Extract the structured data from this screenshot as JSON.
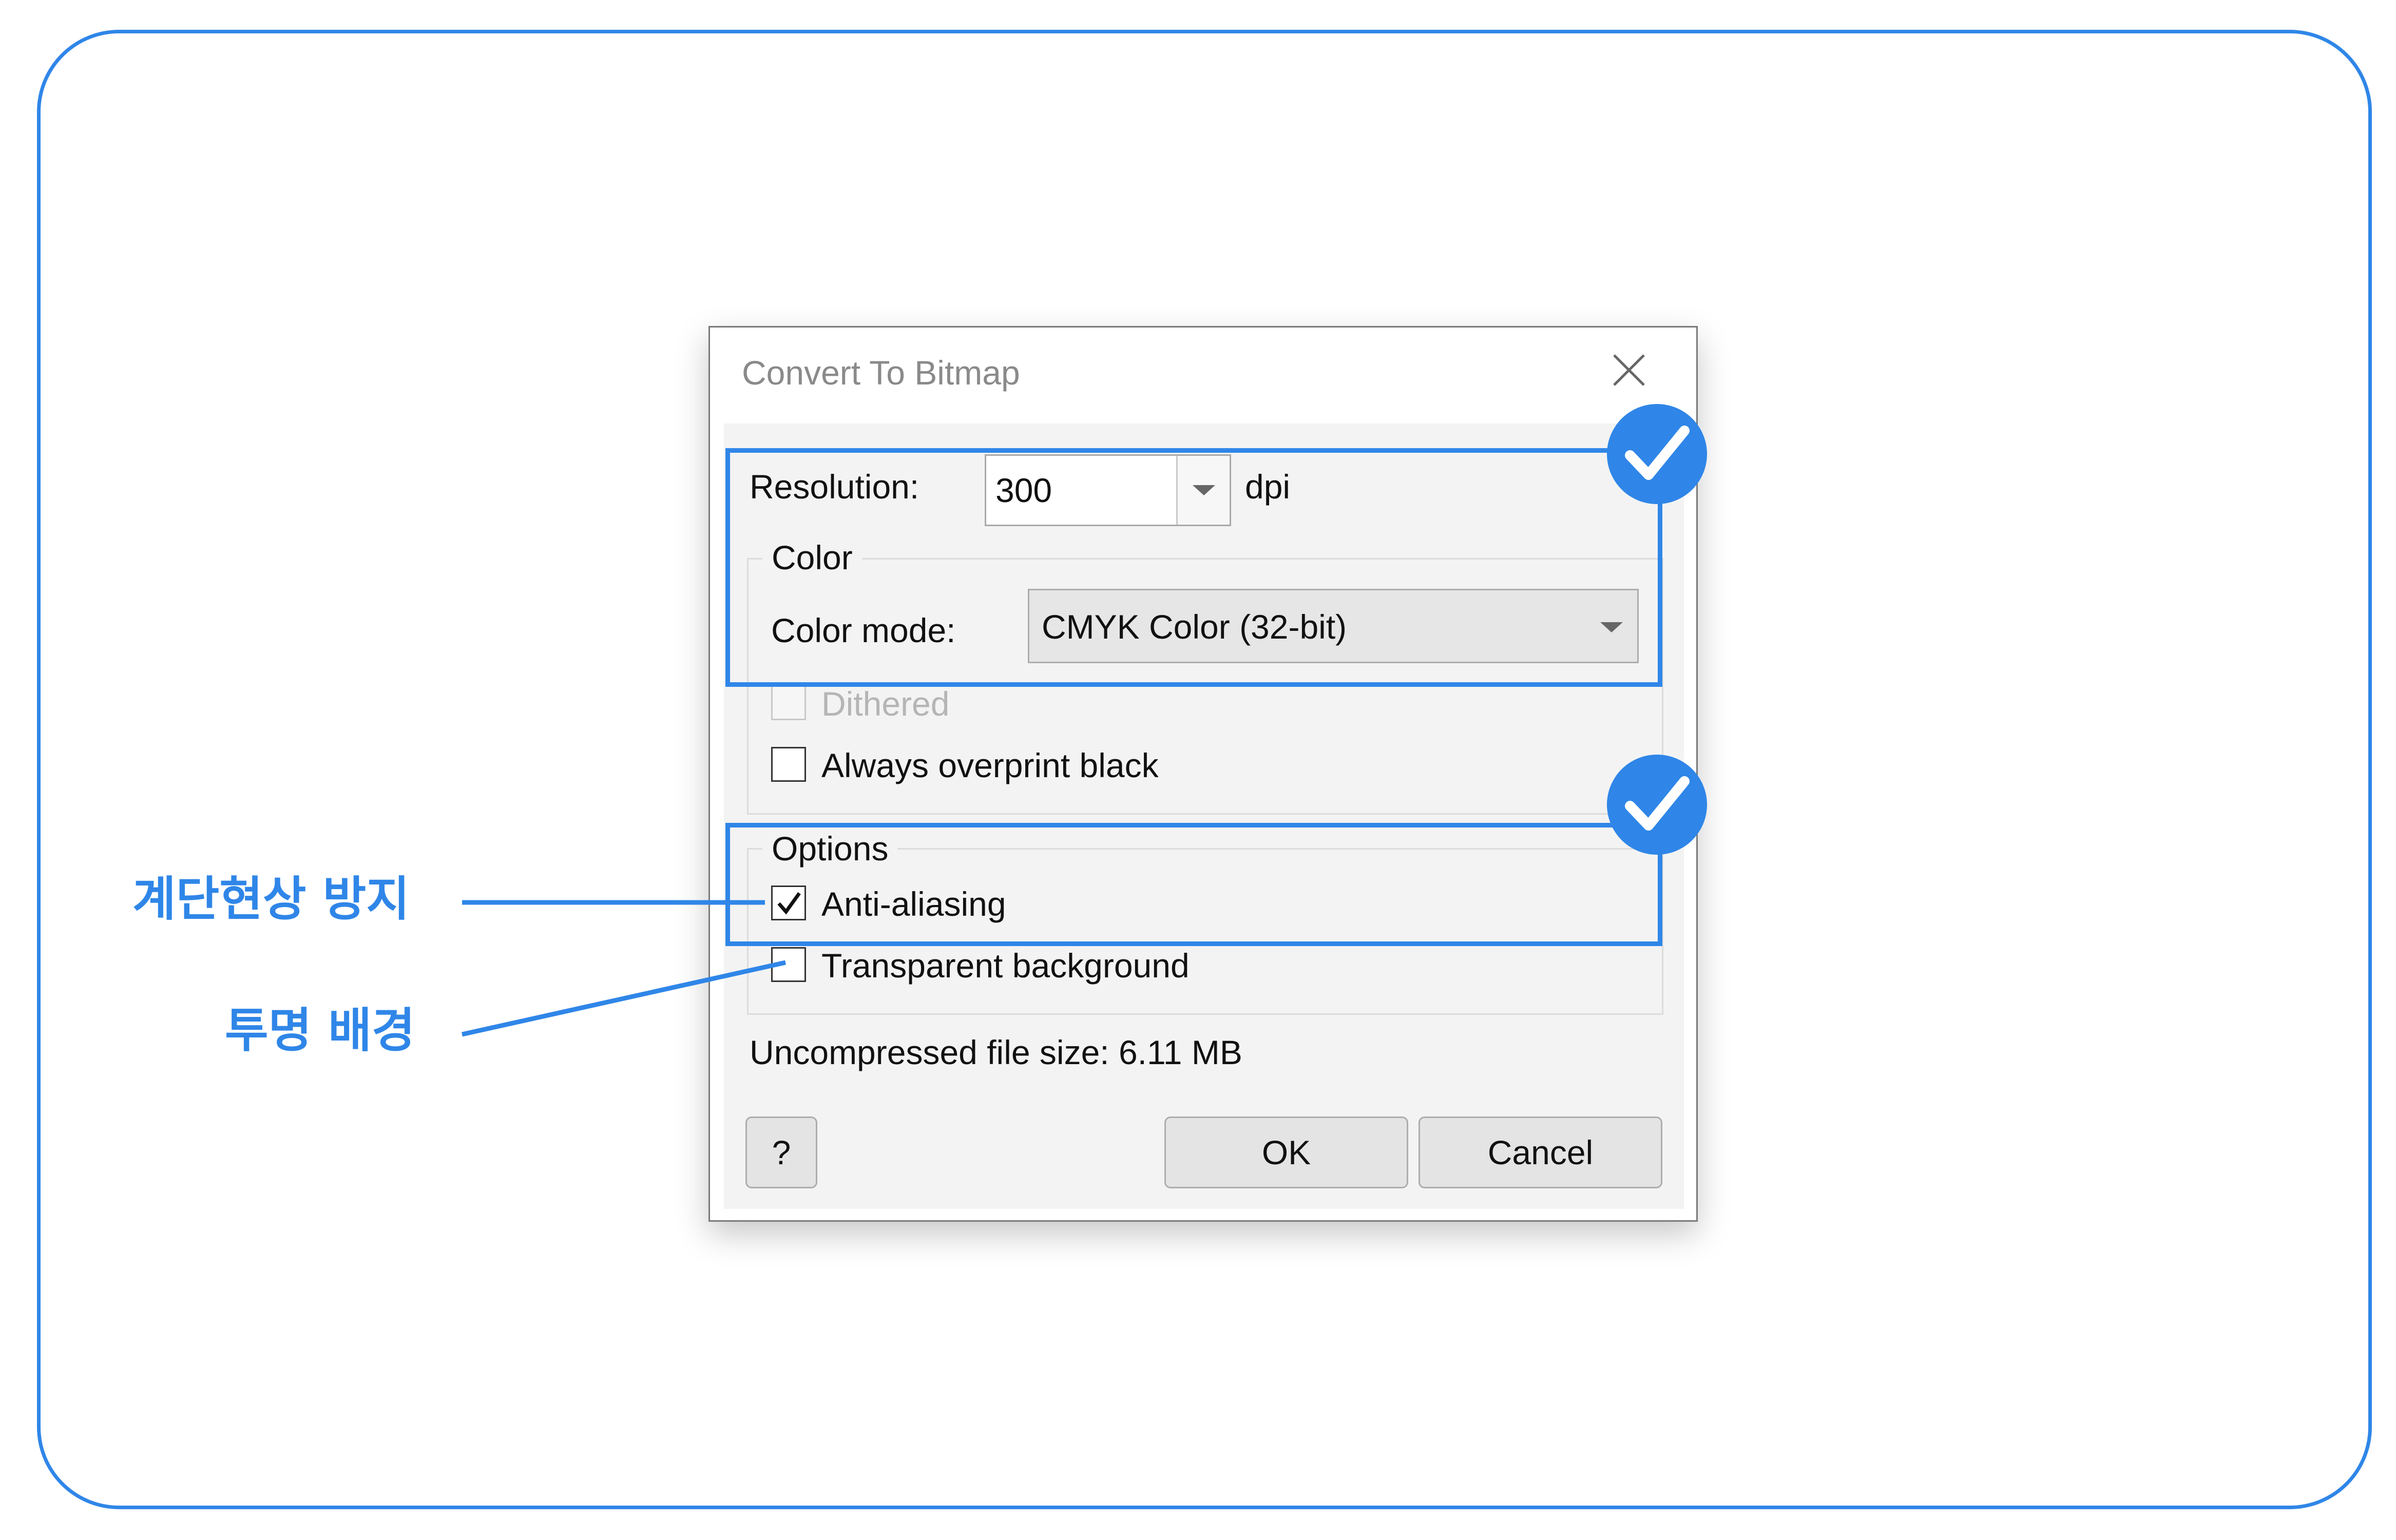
{
  "dialog": {
    "title": "Convert To Bitmap",
    "resolution": {
      "label": "Resolution:",
      "value": "300",
      "unit": "dpi"
    },
    "color_group": {
      "legend": "Color",
      "mode_label": "Color mode:",
      "mode_value": "CMYK Color (32-bit)",
      "dithered": {
        "label": "Dithered",
        "checked": false,
        "enabled": false
      },
      "overprint": {
        "label": "Always overprint black",
        "checked": false,
        "enabled": true
      }
    },
    "options_group": {
      "legend": "Options",
      "anti_aliasing": {
        "label": "Anti-aliasing",
        "checked": true
      },
      "transparent": {
        "label": "Transparent background",
        "checked": false
      }
    },
    "file_size": "Uncompressed file size: 6.11 MB",
    "buttons": {
      "help": "?",
      "ok": "OK",
      "cancel": "Cancel"
    }
  },
  "annotations": {
    "anti_aliasing_note": "계단현상 방지",
    "transparent_note": "투명 배경"
  },
  "colors": {
    "accent": "#2f86e8"
  }
}
